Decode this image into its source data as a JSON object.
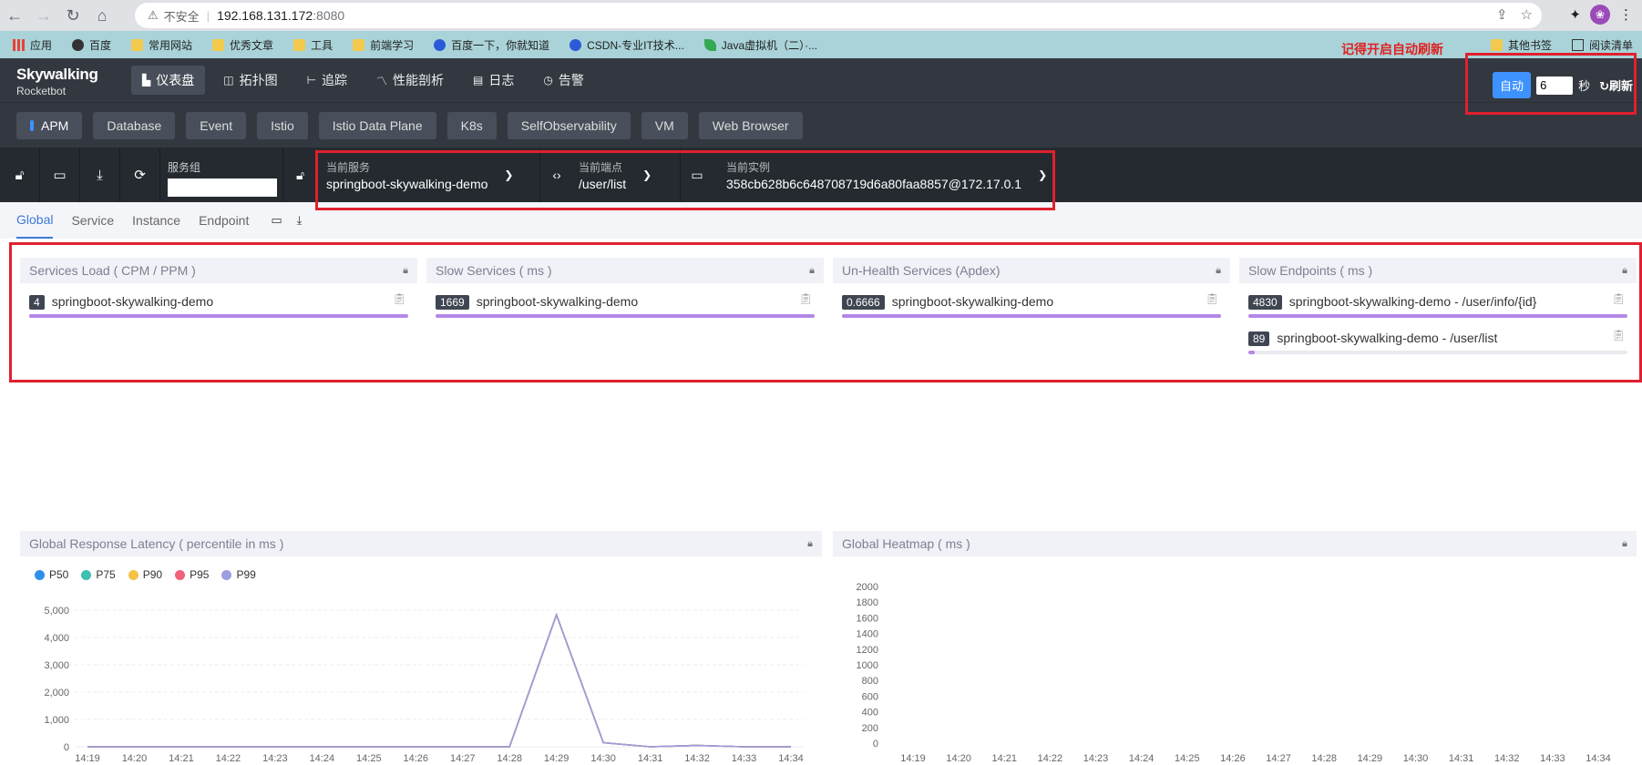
{
  "browser": {
    "security_label": "不安全",
    "url_host": "192.168.131.172",
    "url_port": ":8080",
    "avatar_letter": "❀"
  },
  "bookmarks": {
    "items": [
      "应用",
      "百度",
      "常用网站",
      "优秀文章",
      "工具",
      "前端学习",
      "百度一下，你就知道",
      "CSDN-专业IT技术...",
      "Java虚拟机（二）·..."
    ],
    "other": "其他书签",
    "reading": "阅读清单"
  },
  "annotation": "记得开启自动刷新",
  "app": {
    "logo_top": "Skywalking",
    "logo_bottom": "Rocketbot",
    "nav": [
      "仪表盘",
      "拓扑图",
      "追踪",
      "性能剖析",
      "日志",
      "告警"
    ],
    "auto_label": "自动",
    "auto_value": "6",
    "seconds_label": "秒",
    "refresh_label": "刷新"
  },
  "layers": [
    "APM",
    "Database",
    "Event",
    "Istio",
    "Istio Data Plane",
    "K8s",
    "SelfObservability",
    "VM",
    "Web Browser"
  ],
  "selectors": {
    "service_group_label": "服务组",
    "service_label": "当前服务",
    "service_value": "springboot-skywalking-demo",
    "endpoint_label": "当前端点",
    "endpoint_value": "/user/list",
    "instance_label": "当前实例",
    "instance_value": "358cb628b6c648708719d6a80faa8857@172.17.0.1"
  },
  "tabs": [
    "Global",
    "Service",
    "Instance",
    "Endpoint"
  ],
  "panels": {
    "services_load": {
      "title": "Services Load ( CPM / PPM )",
      "rows": [
        {
          "value": "4",
          "name": "springboot-skywalking-demo",
          "fraction": 1.0
        }
      ]
    },
    "slow_services": {
      "title": "Slow Services ( ms )",
      "rows": [
        {
          "value": "1669",
          "name": "springboot-skywalking-demo",
          "fraction": 1.0
        }
      ]
    },
    "unhealth": {
      "title": "Un-Health Services (Apdex)",
      "rows": [
        {
          "value": "0.6666",
          "name": "springboot-skywalking-demo",
          "fraction": 1.0
        }
      ]
    },
    "slow_endpoints": {
      "title": "Slow Endpoints ( ms )",
      "rows": [
        {
          "value": "4830",
          "name": "springboot-skywalking-demo - /user/info/{id}",
          "fraction": 1.0
        },
        {
          "value": "89",
          "name": "springboot-skywalking-demo - /user/list",
          "fraction": 0.018
        }
      ]
    },
    "latency": {
      "title": "Global Response Latency ( percentile in ms )"
    },
    "heatmap": {
      "title": "Global Heatmap ( ms )"
    }
  },
  "colors": {
    "accent": "#3d92ff",
    "highlight_red": "#e0202e",
    "bar_fill": "#b388e6"
  },
  "chart_data": [
    {
      "type": "line",
      "x": [
        "14:19",
        "14:20",
        "14:21",
        "14:22",
        "14:23",
        "14:24",
        "14:25",
        "14:26",
        "14:27",
        "14:28",
        "14:29",
        "14:30",
        "14:31",
        "14:32",
        "14:33",
        "14:34"
      ],
      "series": [
        {
          "name": "P50",
          "color": "#2f8fe8",
          "values": [
            0,
            0,
            0,
            0,
            0,
            0,
            0,
            0,
            0,
            0,
            4830,
            150,
            0,
            50,
            0,
            0
          ]
        },
        {
          "name": "P75",
          "color": "#3dbfb1",
          "values": [
            0,
            0,
            0,
            0,
            0,
            0,
            0,
            0,
            0,
            0,
            4830,
            150,
            0,
            50,
            0,
            0
          ]
        },
        {
          "name": "P90",
          "color": "#f6c245",
          "values": [
            0,
            0,
            0,
            0,
            0,
            0,
            0,
            0,
            0,
            0,
            4830,
            150,
            0,
            50,
            0,
            0
          ]
        },
        {
          "name": "P95",
          "color": "#f0617a",
          "values": [
            0,
            0,
            0,
            0,
            0,
            0,
            0,
            0,
            0,
            0,
            4830,
            150,
            0,
            50,
            0,
            0
          ]
        },
        {
          "name": "P99",
          "color": "#9c9ee0",
          "values": [
            0,
            0,
            0,
            0,
            0,
            0,
            0,
            0,
            0,
            0,
            4830,
            150,
            0,
            50,
            0,
            0
          ]
        }
      ],
      "yticks": [
        "0",
        "1,000",
        "2,000",
        "3,000",
        "4,000",
        "5,000"
      ],
      "ylim": [
        0,
        5000
      ],
      "grid": true,
      "legend": "top-left"
    },
    {
      "type": "heatmap",
      "x": [
        "14:19",
        "14:20",
        "14:21",
        "14:22",
        "14:23",
        "14:24",
        "14:25",
        "14:26",
        "14:27",
        "14:28",
        "14:29",
        "14:30",
        "14:31",
        "14:32",
        "14:33",
        "14:34"
      ],
      "yticks": [
        "0",
        "200",
        "400",
        "600",
        "800",
        "1000",
        "1200",
        "1400",
        "1600",
        "1800",
        "2000"
      ],
      "ylim": [
        0,
        2000
      ]
    }
  ]
}
